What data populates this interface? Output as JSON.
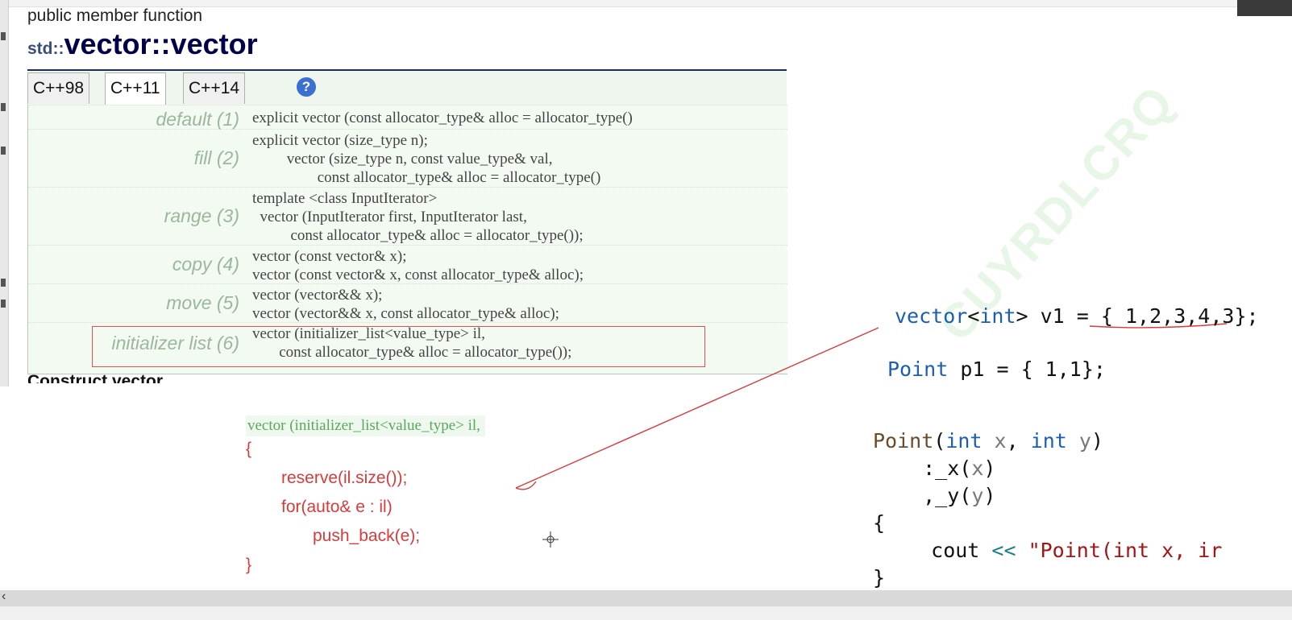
{
  "reference": {
    "kind": "public member function",
    "title_ns": "std::",
    "title_name": "vector",
    "title_sep": "::",
    "title_member": "vector",
    "tabs": [
      "C++98",
      "C++11",
      "C++14"
    ],
    "selected_tab": "C++11",
    "help_icon": "?",
    "prototypes": [
      {
        "label": "default (1)",
        "code": "explicit vector (const allocator_type& alloc = allocator_type()"
      },
      {
        "label": "fill (2)",
        "code": "explicit vector (size_type n);\n         vector (size_type n, const value_type& val,\n                 const allocator_type& alloc = allocator_type()"
      },
      {
        "label": "range (3)",
        "code": "template <class InputIterator>\n  vector (InputIterator first, InputIterator last,\n          const allocator_type& alloc = allocator_type());"
      },
      {
        "label": "copy (4)",
        "code": "vector (const vector& x);\nvector (const vector& x, const allocator_type& alloc);"
      },
      {
        "label": "move (5)",
        "code": "vector (vector&& x);\nvector (vector&& x, const allocator_type& alloc);"
      },
      {
        "label": "initializer list (6)",
        "code": "vector (initializer_list<value_type> il,\n       const allocator_type& alloc = allocator_type());"
      }
    ],
    "next_heading": "Construct vector"
  },
  "impl": {
    "header": "vector (initializer_list<value_type> il,",
    "lines": [
      "{",
      "reserve(il.size());",
      "for(auto& e : il)",
      "push_back(e);",
      "}"
    ]
  },
  "right": {
    "v1_type": "vector",
    "v1_tpl_open": "<",
    "v1_tpl_kw": "int",
    "v1_rest": "> v1 = { 1,2,3,4,3};",
    "p1_type": "Point",
    "p1_rest": " p1 = { 1,1};",
    "ctor_name": "Point",
    "ctor_open": "(",
    "ctor_int1": "int",
    "ctor_x": " x",
    "ctor_comma": ", ",
    "ctor_int2": "int",
    "ctor_y": " y",
    "ctor_close": ")",
    "init_x_pre": "  :_x(",
    "init_x_arg": "x",
    "init_x_post": ")",
    "init_y_pre": "  ,_y(",
    "init_y_arg": "y",
    "init_y_post": ")",
    "brace_open": "{",
    "cout_kw": "   cout ",
    "cout_op": "<<",
    "cout_str": " \"Point(int x, ir",
    "brace_close": "}"
  },
  "watermark": "CUYRDLCRQ",
  "colors": {
    "accent_red": "#d93a3a",
    "label_green": "#9cb79c",
    "keyword_blue": "#1a5fb4"
  }
}
